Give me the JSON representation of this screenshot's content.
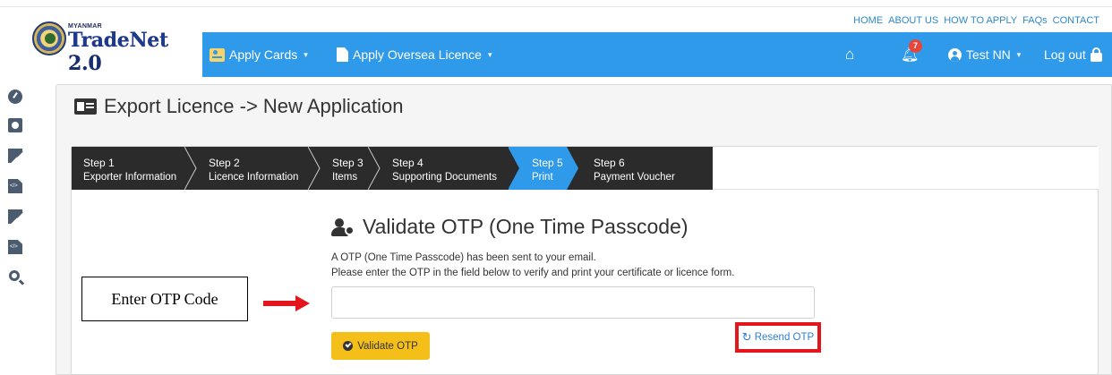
{
  "logo": {
    "top_text": "MYANMAR",
    "brand": "TradeNet",
    "version": "2.0"
  },
  "top_links": [
    "HOME",
    "ABOUT US",
    "HOW TO APPLY",
    "FAQs",
    "CONTACT"
  ],
  "navbar": {
    "apply_cards": "Apply Cards",
    "apply_oversea": "Apply Oversea Licence",
    "notification_count": "7",
    "user": "Test NN",
    "logout": "Log out",
    "color": "#2f9aea"
  },
  "sidebar_icons": [
    "dashboard-icon",
    "id-card-icon",
    "edit-icon",
    "code-file-icon",
    "edit-icon",
    "code-file-icon",
    "search-icon"
  ],
  "panel": {
    "title": "Export Licence -> New Application"
  },
  "steps": [
    {
      "number": "Step 1",
      "label": "Exporter Information",
      "active": false
    },
    {
      "number": "Step 2",
      "label": "Licence Information",
      "active": false
    },
    {
      "number": "Step 3",
      "label": "Items",
      "active": false
    },
    {
      "number": "Step 4",
      "label": "Supporting Documents",
      "active": false
    },
    {
      "number": "Step 5",
      "label": "Print",
      "active": true
    },
    {
      "number": "Step 6",
      "label": "Payment Voucher",
      "active": false
    }
  ],
  "validate": {
    "title": "Validate OTP (One Time Passcode)",
    "line1": "A OTP (One Time Passcode) has been sent to your email.",
    "line2": "Please enter the OTP in the field below to verify and print your certificate or licence form.",
    "otp_value": "",
    "otp_placeholder": "",
    "validate_button": "Validate OTP",
    "resend_link": "Resend OTP"
  },
  "annotation": {
    "label": "Enter OTP Code",
    "highlight_color": "#e4151b"
  }
}
